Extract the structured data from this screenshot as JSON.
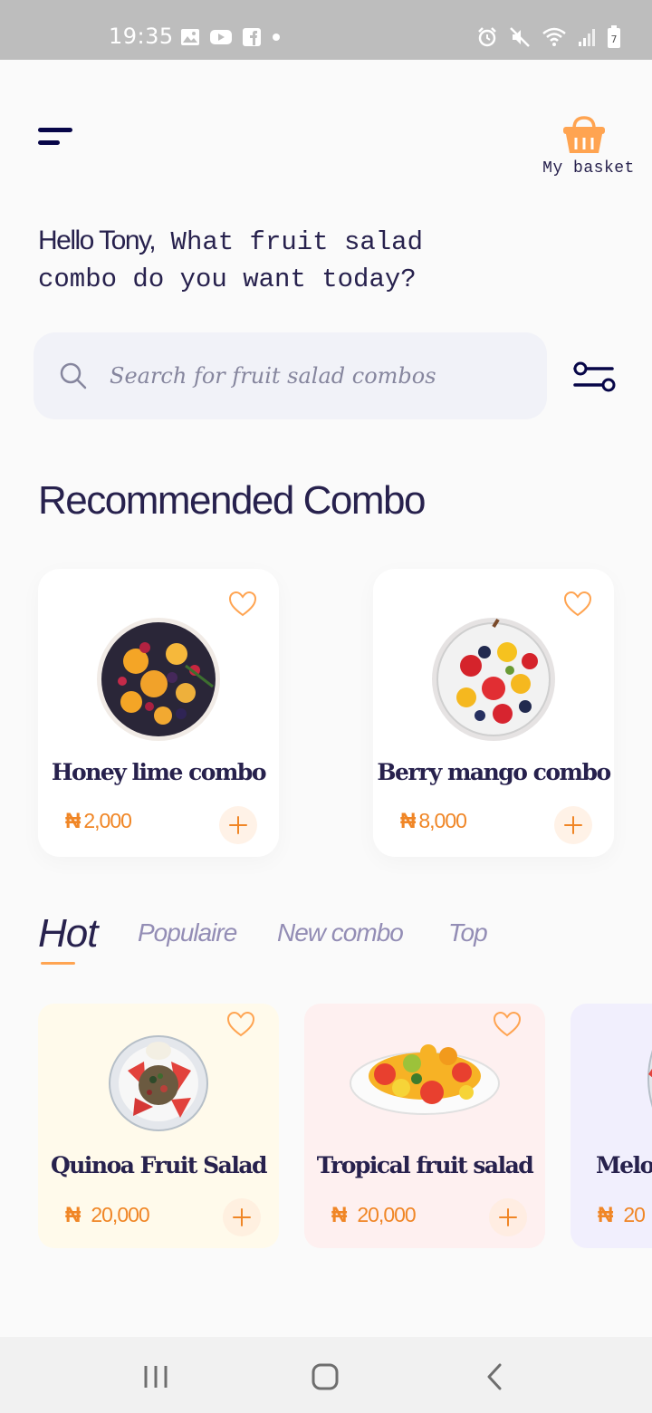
{
  "status_bar": {
    "time": "19:35",
    "left_icons": [
      "gallery-icon",
      "youtube-icon",
      "facebook-icon",
      "dot-icon"
    ],
    "right_icons": [
      "alarm-icon",
      "mute-icon",
      "wifi-icon",
      "signal-icon",
      "battery-icon"
    ],
    "battery_level": "7"
  },
  "header": {
    "menu_icon": "menu-icon",
    "basket_icon": "basket-icon",
    "basket_label": "My basket"
  },
  "greeting": {
    "hello": "Hello Tony,",
    "question": " What fruit salad combo do you want today?"
  },
  "search": {
    "placeholder": "Search for fruit salad combos",
    "value": "",
    "icon": "search-icon",
    "filter_icon": "filter-icon"
  },
  "recommended": {
    "title": "Recommended Combo",
    "items": [
      {
        "name": "Honey lime combo",
        "currency": "₦",
        "price": "2,000",
        "favorite": false
      },
      {
        "name": "Berry mango combo",
        "currency": "₦",
        "price": "8,000",
        "favorite": false
      }
    ]
  },
  "tabs": {
    "items": [
      "Hot",
      "Populaire",
      "New combo",
      "Top"
    ],
    "active": "Hot"
  },
  "hot": {
    "items": [
      {
        "name": "Quinoa Fruit Salad",
        "currency": "₦",
        "price": "20,000",
        "bg": "#fffaeb"
      },
      {
        "name": "Tropical fruit salad",
        "currency": "₦",
        "price": "20,000",
        "bg": "#fef0f0"
      },
      {
        "name": "Melo",
        "currency": "₦",
        "price": "20",
        "bg": "#f1effd"
      }
    ]
  },
  "colors": {
    "accent": "#ffa451",
    "price": "#f08626",
    "primary_text": "#27214d",
    "muted_tab": "#938db5"
  },
  "nav_bar": {
    "icons": [
      "recents-icon",
      "home-icon",
      "back-icon"
    ]
  }
}
